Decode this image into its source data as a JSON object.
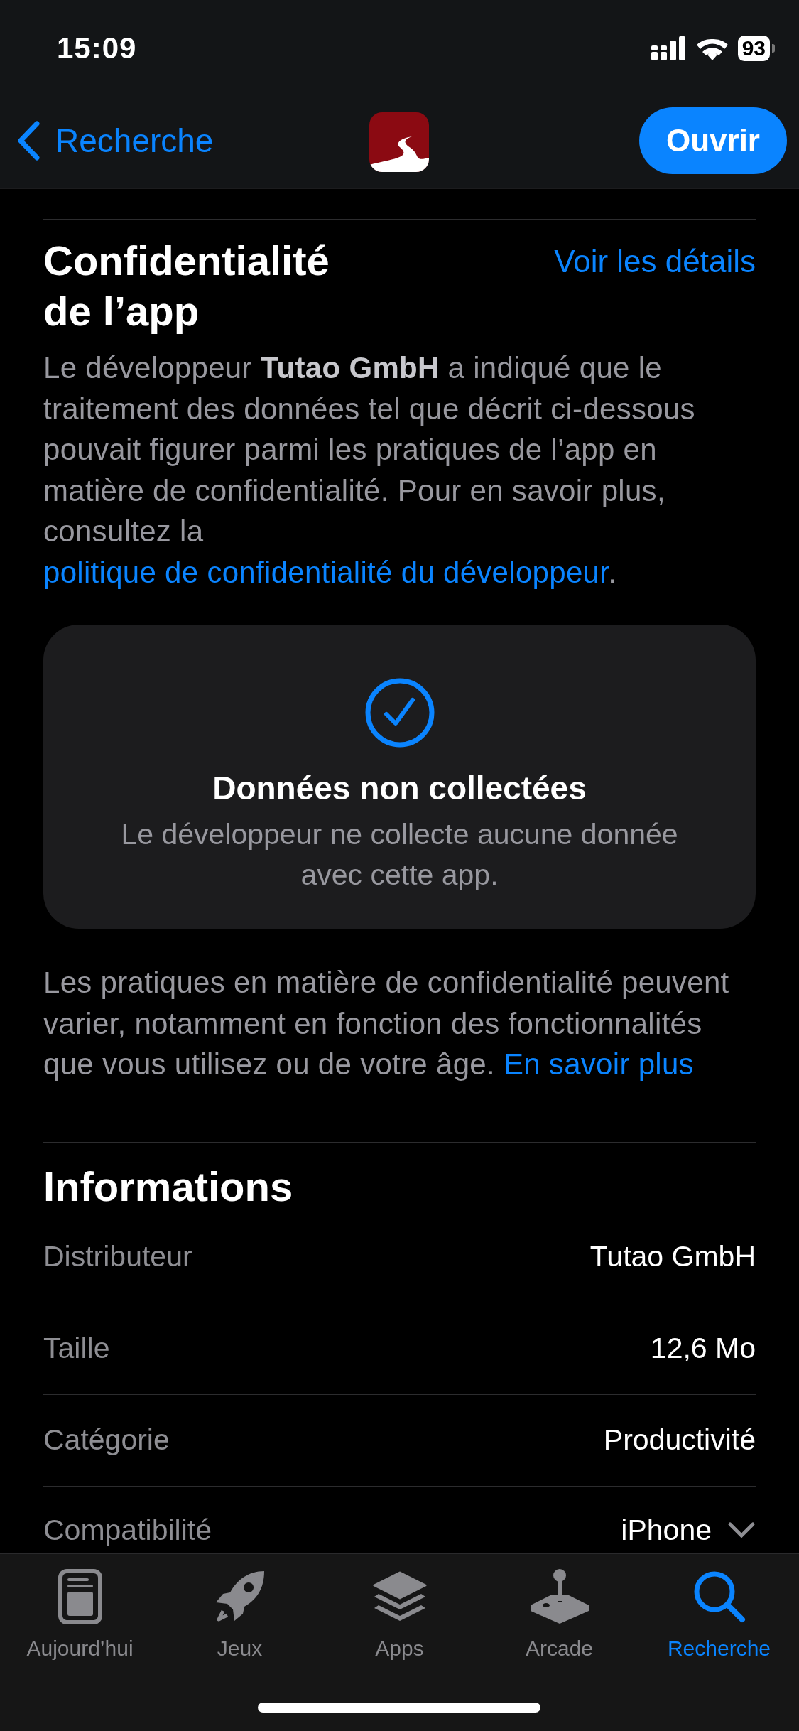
{
  "status_bar": {
    "time": "15:09",
    "battery": "93"
  },
  "nav_bar": {
    "back_label": "Recherche",
    "action_button": "Ouvrir"
  },
  "privacy": {
    "title": "Confidentialité de l’app",
    "details_link": "Voir les détails",
    "intro": "Le développeur **Tutao GmbH** a indiqué que le traitement des données tel que décrit ci-dessous pouvait figurer parmi les pratiques de l’app en matière de confidentialité. Pour en savoir plus, consultez la",
    "intro_link": "politique de confidentialité du développeur",
    "intro_end": ".",
    "card": {
      "title": "Données non collectées",
      "text": "Le développeur ne collecte aucune donnée avec cette app."
    },
    "note": "Les pratiques en matière de confidentialité peuvent varier, notamment en fonction des fonctionnalités que vous utilisez ou de votre âge.",
    "note_link": "En savoir plus"
  },
  "informations": {
    "title": "Informations",
    "rows": [
      {
        "label": "Distributeur",
        "value": "Tutao GmbH",
        "expandable": false
      },
      {
        "label": "Taille",
        "value": "12,6 Mo",
        "expandable": false
      },
      {
        "label": "Catégorie",
        "value": "Productivité",
        "expandable": false
      },
      {
        "label": "Compatibilité",
        "value": "iPhone",
        "expandable": true
      }
    ]
  },
  "tab_bar": [
    {
      "label": "Aujourd’hui",
      "selected": false
    },
    {
      "label": "Jeux",
      "selected": false
    },
    {
      "label": "Apps",
      "selected": false
    },
    {
      "label": "Arcade",
      "selected": false
    },
    {
      "label": "Recherche",
      "selected": true
    }
  ]
}
